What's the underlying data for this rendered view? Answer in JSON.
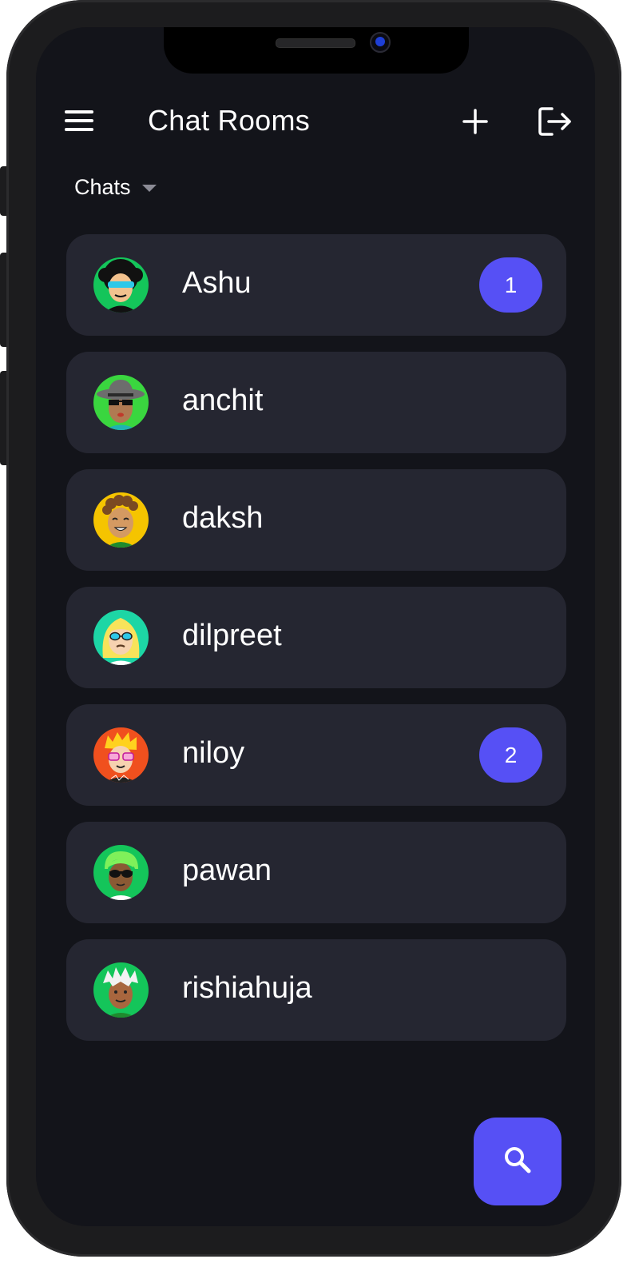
{
  "header": {
    "title": "Chat Rooms"
  },
  "filter": {
    "selected": "Chats"
  },
  "chats": [
    {
      "name": "Ashu",
      "unread": "1",
      "avatar_bg": "#14c55a"
    },
    {
      "name": "anchit",
      "unread": null,
      "avatar_bg": "#3ad63f"
    },
    {
      "name": "daksh",
      "unread": null,
      "avatar_bg": "#f5c400"
    },
    {
      "name": "dilpreet",
      "unread": null,
      "avatar_bg": "#1dd6a5"
    },
    {
      "name": "niloy",
      "unread": "2",
      "avatar_bg": "#f0501e"
    },
    {
      "name": "pawan",
      "unread": null,
      "avatar_bg": "#14c55a"
    },
    {
      "name": "rishiahuja",
      "unread": null,
      "avatar_bg": "#14c55a"
    }
  ],
  "colors": {
    "accent": "#5650f5",
    "background": "#13141a",
    "card": "#252631"
  },
  "icons": {
    "menu": "hamburger-menu-icon",
    "add": "plus-icon",
    "logout": "logout-icon",
    "search": "search-icon"
  }
}
